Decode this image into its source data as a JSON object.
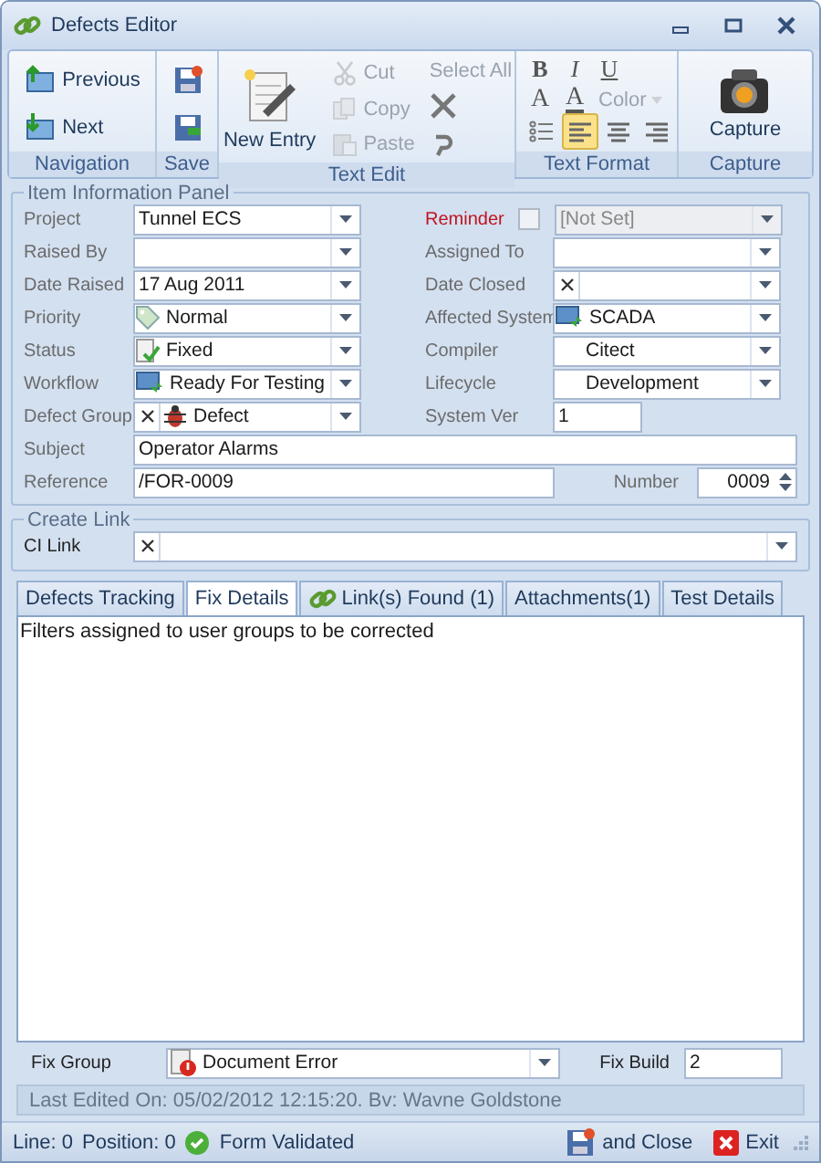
{
  "window": {
    "title": "Defects Editor"
  },
  "ribbon": {
    "groups": [
      {
        "caption": "Navigation",
        "lines": [
          [
            {
              "label": "Previous",
              "kind": "small",
              "disabled": false
            },
            {
              "label": "Next",
              "kind": "small",
              "disabled": false
            }
          ]
        ]
      },
      {
        "caption": "Save",
        "lines": [
          [
            {
              "kind": "icon",
              "disabled": false
            },
            {
              "kind": "icon",
              "disabled": false
            }
          ]
        ]
      },
      {
        "caption": "Text Edit",
        "lines": [
          [
            {
              "label": "New Entry",
              "kind": "large",
              "disabled": false
            }
          ],
          [
            {
              "label": "Cut",
              "kind": "small",
              "disabled": true
            },
            {
              "label": "Copy",
              "kind": "small",
              "disabled": true
            },
            {
              "label": "Paste",
              "kind": "small",
              "disabled": true
            }
          ],
          [
            {
              "label": "Select All",
              "kind": "small",
              "disabled": true
            },
            {
              "kind": "icon",
              "disabled": false
            },
            {
              "kind": "icon",
              "disabled": false
            }
          ]
        ]
      },
      {
        "caption": "Text Format",
        "lines": [
          [
            {
              "label": "B",
              "kind": "glyph",
              "disabled": false,
              "selected": false
            },
            {
              "label": "I",
              "kind": "glyph",
              "disabled": false,
              "selected": false
            },
            {
              "label": "U",
              "kind": "glyph",
              "disabled": false,
              "selected": false
            }
          ],
          [
            {
              "label": "A",
              "kind": "glyph",
              "disabled": false,
              "selected": false
            },
            {
              "label": "A",
              "kind": "glyph",
              "disabled": false,
              "selected": false
            },
            {
              "label": "Color",
              "kind": "small",
              "disabled": true,
              "selected": false
            }
          ],
          [
            {
              "kind": "icon",
              "disabled": false,
              "selected": false
            },
            {
              "kind": "icon",
              "disabled": false,
              "selected": true
            },
            {
              "kind": "icon",
              "disabled": false,
              "selected": false
            },
            {
              "kind": "icon",
              "disabled": false,
              "selected": false
            }
          ]
        ]
      },
      {
        "caption": "Capture",
        "lines": [
          [
            {
              "label": "Capture",
              "kind": "large",
              "disabled": false
            }
          ]
        ]
      }
    ]
  },
  "item_panel": {
    "title": "Item Information Panel",
    "rows": [
      [
        {
          "label": "Project",
          "kind": "combo",
          "value": "Tunnel ECS"
        },
        {
          "label": "Reminder",
          "kind": "reminder",
          "value": "[Not Set]",
          "highlighted": true,
          "checked": false,
          "disabled": true
        }
      ],
      [
        {
          "label": "Raised By",
          "kind": "combo"
        },
        {
          "label": "Assigned To",
          "kind": "combo"
        }
      ],
      [
        {
          "label": "Date Raised",
          "kind": "combo",
          "value": "17 Aug 2011"
        },
        {
          "label": "Date Closed",
          "kind": "combo",
          "clearable": true
        }
      ],
      [
        {
          "label": "Priority",
          "kind": "combo",
          "value": "Normal"
        },
        {
          "label": "Affected System",
          "kind": "combo",
          "value": "SCADA"
        }
      ],
      [
        {
          "label": "Status",
          "kind": "combo",
          "value": "Fixed"
        },
        {
          "label": "Compiler",
          "kind": "combo",
          "value": "Citect"
        }
      ],
      [
        {
          "label": "Workflow",
          "kind": "combo",
          "value": "Ready For Testing"
        },
        {
          "label": "Lifecycle",
          "kind": "combo",
          "value": "Development"
        }
      ],
      [
        {
          "label": "Defect Group",
          "kind": "combo",
          "value": "Defect",
          "clearable": true
        },
        {
          "label": "System Ver",
          "kind": "text",
          "value": "1"
        }
      ],
      [
        {
          "label": "Subject",
          "kind": "wide",
          "value": "Operator Alarms"
        }
      ],
      [
        {
          "label": "Reference",
          "kind": "reference",
          "value": "/FOR-0009"
        },
        {
          "label": "Number",
          "kind": "spin",
          "value": "0009"
        }
      ]
    ]
  },
  "link_panel": {
    "title": "Create Link",
    "label": "CI Link",
    "clearable": true
  },
  "tabs": [
    {
      "label": "Defects Tracking",
      "selected": false
    },
    {
      "label": "Fix Details",
      "selected": true
    },
    {
      "label": "Link(s) Found (1)",
      "selected": false
    },
    {
      "label": "Attachments(1)",
      "selected": false
    },
    {
      "label": "Test Details",
      "selected": false
    }
  ],
  "fix_details": {
    "text": "Filters assigned to user groups to be corrected"
  },
  "fix_row": {
    "group_label": "Fix Group",
    "group_value": "Document Error",
    "build_label": "Fix Build",
    "build_value": "2"
  },
  "last_edited": "Last Edited On: 05/02/2012 12:15:20. Bv: Wavne Goldstone",
  "status_bar": {
    "line": "Line: 0",
    "position": "Position: 0",
    "validation": "Form Validated",
    "buttons": [
      "and Close",
      "Exit"
    ]
  }
}
